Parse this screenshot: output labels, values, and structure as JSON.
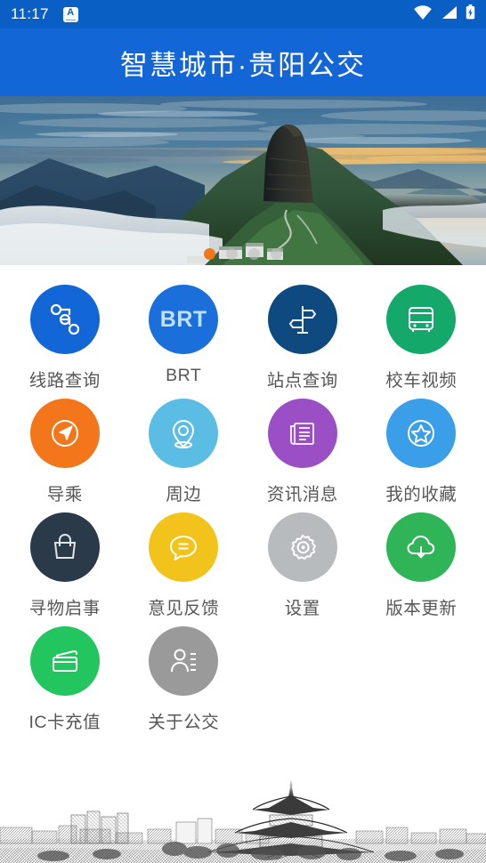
{
  "status_bar": {
    "time": "11:17",
    "app_badge_letter": "A",
    "icons": [
      "wifi-icon",
      "signal-icon",
      "battery-charging-icon"
    ]
  },
  "header": {
    "title": "智慧城市·贵阳公交"
  },
  "banner": {
    "alt": "梵净山日出云海",
    "pager": {
      "count": 4,
      "active_index": 0
    },
    "active_dot_color": "#f4761a",
    "inactive_dot_color": "#bebebe"
  },
  "grid": {
    "items": [
      {
        "label": "线路查询",
        "icon": "route-nodes-icon",
        "color": "#1266d6"
      },
      {
        "label": "BRT",
        "icon": "brt-text-icon",
        "color": "#1a6fdb"
      },
      {
        "label": "站点查询",
        "icon": "signpost-icon",
        "color": "#0e4a7f"
      },
      {
        "label": "校车视频",
        "icon": "bus-icon",
        "color": "#14a86a"
      },
      {
        "label": "导乘",
        "icon": "compass-icon",
        "color": "#f4761a"
      },
      {
        "label": "周边",
        "icon": "map-pin-icon",
        "color": "#5bbce4"
      },
      {
        "label": "资讯消息",
        "icon": "newspaper-icon",
        "color": "#9b4fc4"
      },
      {
        "label": "我的收藏",
        "icon": "star-circle-icon",
        "color": "#3a9fe8"
      },
      {
        "label": "寻物启事",
        "icon": "handbag-icon",
        "color": "#2b3a49"
      },
      {
        "label": "意见反馈",
        "icon": "speech-bubble-icon",
        "color": "#f2c41b"
      },
      {
        "label": "设置",
        "icon": "gear-icon",
        "color": "#b7bbbd"
      },
      {
        "label": "版本更新",
        "icon": "cloud-download-icon",
        "color": "#2fb457"
      },
      {
        "label": "IC卡充值",
        "icon": "ic-card-icon",
        "color": "#22c55e"
      },
      {
        "label": "关于公交",
        "icon": "user-info-icon",
        "color": "#9a9a9a"
      }
    ]
  },
  "footer": {
    "alt": "贵阳甲秀楼城市素描"
  },
  "theme": {
    "status_bar_bg": "#0a5fc4",
    "header_bg": "#1266d6",
    "label_color": "#575757",
    "page_bg": "#ffffff"
  }
}
